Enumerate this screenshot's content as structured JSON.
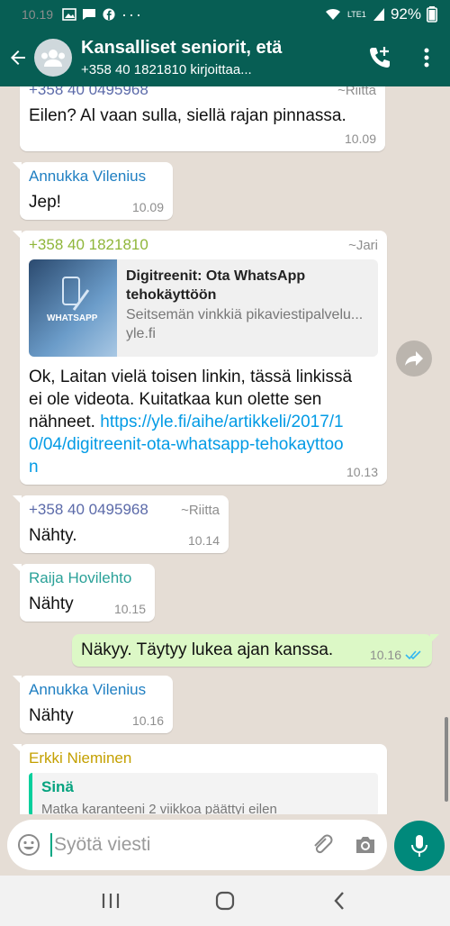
{
  "status_bar": {
    "time": "10.19",
    "network": "LTE1",
    "battery": "92%"
  },
  "header": {
    "title": "Kansalliset seniorit, etä",
    "subtitle": "+358 40 1821810 kirjoittaa..."
  },
  "messages": [
    {
      "sender_partial": "+358 40 0495968",
      "pushname_partial": "~Riitta",
      "text": "Eilen? Al vaan sulla, siellä rajan pinnassa.",
      "time": "10.09"
    },
    {
      "sender": "Annukka Vilenius",
      "text": "Jep!",
      "time": "10.09"
    },
    {
      "sender": "+358 40 1821810",
      "pushname": "~Jari",
      "preview": {
        "thumb_label": "WHATSAPP",
        "title": "Digitreenit: Ota WhatsApp tehokäyttöön",
        "description": "Seitsemän vinkkiä pikaviestipalvelu...",
        "host": "yle.fi"
      },
      "text": "Ok, Laitan vielä toisen linkin, tässä linkissä ei ole videota. Kuitatkaa kun olette sen nähneet.",
      "link": "https://yle.fi/aihe/artikkeli/2017/10/04/digitreenit-ota-whatsapp-tehokayttoon",
      "time": "10.13"
    },
    {
      "sender": "+358 40 0495968",
      "pushname": "~Riitta",
      "text": "Nähty.",
      "time": "10.14"
    },
    {
      "sender": "Raija Hovilehto",
      "text": "Nähty",
      "time": "10.15"
    },
    {
      "outgoing": true,
      "text": "Näkyy. Täytyy lukea ajan kanssa.",
      "time": "10.16"
    },
    {
      "sender": "Annukka Vilenius",
      "text": "Nähty",
      "time": "10.16"
    },
    {
      "sender": "Erkki Nieminen",
      "quote_name": "Sinä",
      "quote_text": "Matka karanteeni 2 viikkoa päättyi eilen"
    }
  ],
  "composer": {
    "placeholder": "Syötä viesti"
  },
  "colors": {
    "header": "#075e54",
    "outgoing_bubble": "#dcf8c6",
    "sender_blue": "#1f7fc2",
    "sender_green": "#8fb63a",
    "sender_purple": "#5b6aa9",
    "sender_teal": "#2aa198",
    "sender_gold": "#c4a000",
    "mic": "#00897b"
  }
}
